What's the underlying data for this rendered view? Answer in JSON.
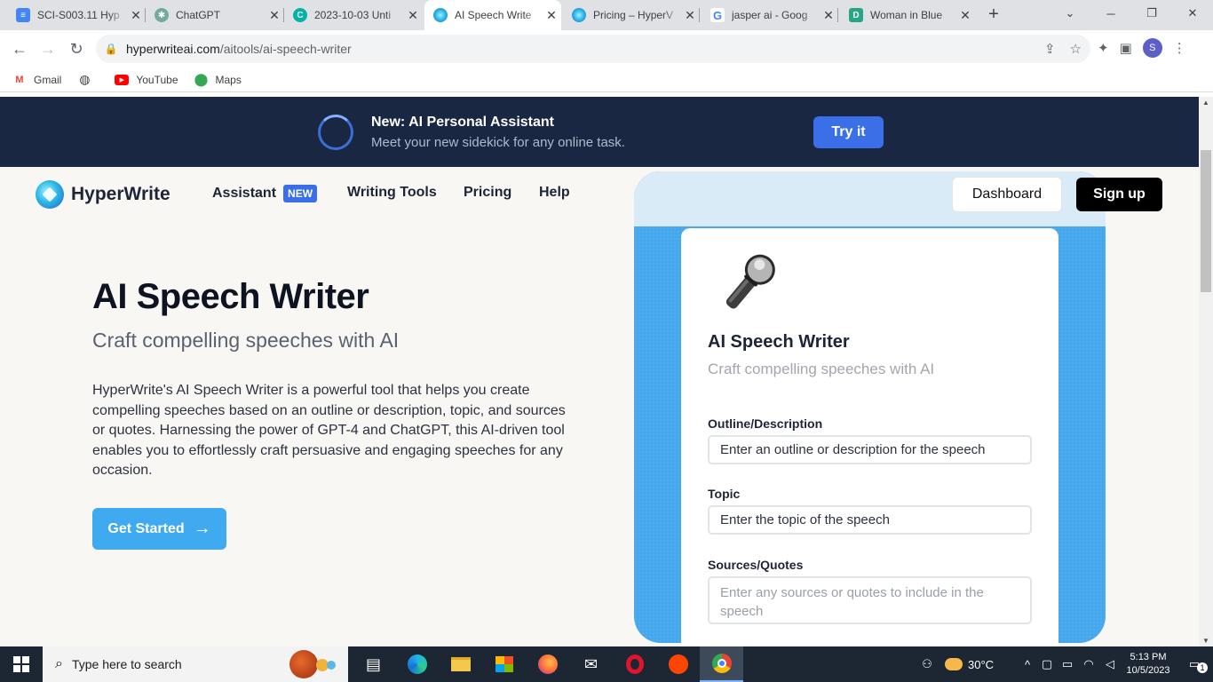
{
  "browser": {
    "tabs": [
      {
        "title": "SCI-S003.11 Hyp",
        "icon": "docs-icon",
        "color": "#4285f4",
        "active": false
      },
      {
        "title": "ChatGPT",
        "icon": "chatgpt-icon",
        "color": "#74aa9c",
        "active": false
      },
      {
        "title": "2023-10-03 Unti",
        "icon": "c-icon",
        "color": "#00b3a6",
        "active": false
      },
      {
        "title": "AI Speech Write",
        "icon": "hyperwrite-icon",
        "color": "#2ab6e6",
        "active": true
      },
      {
        "title": "Pricing – HyperV",
        "icon": "hyperwrite-icon",
        "color": "#2ab6e6",
        "active": false
      },
      {
        "title": "jasper ai - Goog",
        "icon": "google-icon",
        "color": "#4285f4",
        "active": false
      },
      {
        "title": "Woman in Blue",
        "icon": "d-icon",
        "color": "#27a584",
        "active": false
      }
    ],
    "url_host": "hyperwriteai.com",
    "url_path": "/aitools/ai-speech-writer",
    "profile_initial": "S",
    "bookmarks": [
      {
        "label": "Gmail",
        "icon": "gmail-icon"
      },
      {
        "label": "",
        "icon": "globe-icon"
      },
      {
        "label": "YouTube",
        "icon": "youtube-icon"
      },
      {
        "label": "Maps",
        "icon": "maps-icon"
      }
    ]
  },
  "banner": {
    "title": "New: AI Personal Assistant",
    "subtitle": "Meet your new sidekick for any online task.",
    "cta": "Try it"
  },
  "header": {
    "logo_text": "HyperWrite",
    "nav": [
      {
        "label": "Assistant",
        "badge": "NEW"
      },
      {
        "label": "Writing Tools"
      },
      {
        "label": "Pricing"
      },
      {
        "label": "Help"
      }
    ],
    "dashboard": "Dashboard",
    "signup": "Sign up"
  },
  "hero": {
    "title": "AI Speech Writer",
    "subtitle": "Craft compelling speeches with AI",
    "description": "HyperWrite's AI Speech Writer is a powerful tool that helps you create compelling speeches based on an outline or description, topic, and sources or quotes. Harnessing the power of GPT-4 and ChatGPT, this AI-driven tool enables you to effortlessly craft persuasive and engaging speeches for any occasion.",
    "cta": "Get Started"
  },
  "tool_card": {
    "icon": "microphone-icon",
    "title": "AI Speech Writer",
    "subtitle": "Craft compelling speeches with AI",
    "fields": [
      {
        "label": "Outline/Description",
        "value": "Enter an outline or description for the speech"
      },
      {
        "label": "Topic",
        "value": "Enter the topic of the speech"
      },
      {
        "label": "Sources/Quotes",
        "placeholder": "Enter any sources or quotes to include in the speech"
      }
    ]
  },
  "taskbar": {
    "search_placeholder": "Type here to search",
    "weather": "30°C",
    "time": "5:13 PM",
    "date": "10/5/2023",
    "notifications": "1"
  }
}
